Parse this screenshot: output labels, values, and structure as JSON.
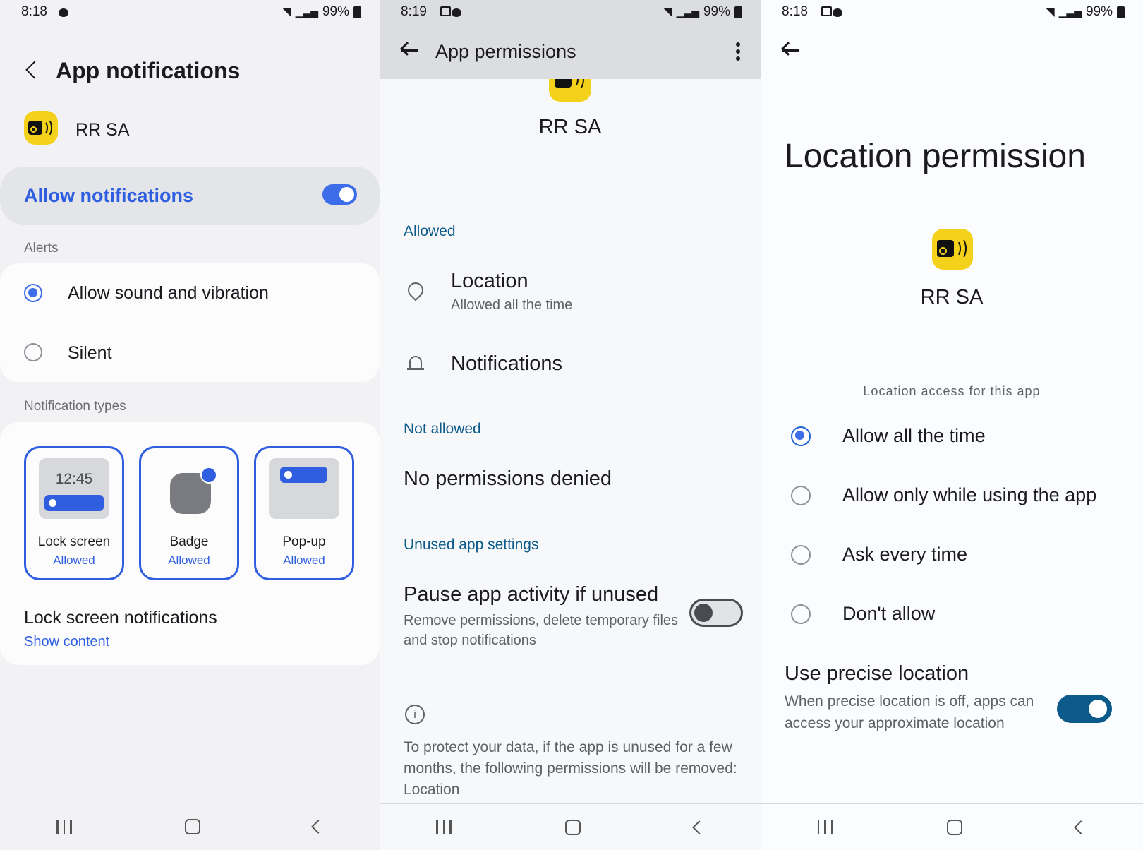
{
  "screen1": {
    "status": {
      "time": "8:18",
      "battery": "99%"
    },
    "title": "App notifications",
    "app_name": "RR SA",
    "allow_label": "Allow notifications",
    "allow_on": true,
    "alerts_header": "Alerts",
    "alert_options": [
      {
        "label": "Allow sound and vibration",
        "selected": true
      },
      {
        "label": "Silent",
        "selected": false
      }
    ],
    "types_header": "Notification types",
    "types": [
      {
        "name": "Lock screen",
        "status": "Allowed",
        "preview_time": "12:45"
      },
      {
        "name": "Badge",
        "status": "Allowed"
      },
      {
        "name": "Pop-up",
        "status": "Allowed"
      }
    ],
    "lock_title": "Lock screen notifications",
    "lock_value": "Show content"
  },
  "screen2": {
    "status": {
      "time": "8:19",
      "battery": "99%"
    },
    "title": "App permissions",
    "app_name": "RR SA",
    "allowed_header": "Allowed",
    "location_title": "Location",
    "location_sub": "Allowed all the time",
    "notifications_title": "Notifications",
    "not_allowed_header": "Not allowed",
    "none_denied": "No permissions denied",
    "unused_header": "Unused app settings",
    "pause_title": "Pause app activity if unused",
    "pause_sub": "Remove permissions, delete temporary files and stop notifications",
    "pause_on": false,
    "info_text": "To protect your data, if the app is unused for a few months, the following permissions will be removed: Location"
  },
  "screen3": {
    "status": {
      "time": "8:18",
      "battery": "99%"
    },
    "title": "Location permission",
    "app_name": "RR SA",
    "access_header": "Location access for this app",
    "options": [
      {
        "label": "Allow all the time",
        "selected": true
      },
      {
        "label": "Allow only while using the app",
        "selected": false
      },
      {
        "label": "Ask every time",
        "selected": false
      },
      {
        "label": "Don't allow",
        "selected": false
      }
    ],
    "precise_title": "Use precise location",
    "precise_sub": "When precise location is off, apps can access your approximate location",
    "precise_on": true
  },
  "colors": {
    "samsung_blue": "#3e6dea",
    "material_teal": "#0b5a8a",
    "app_icon_yellow": "#f4d21c"
  }
}
